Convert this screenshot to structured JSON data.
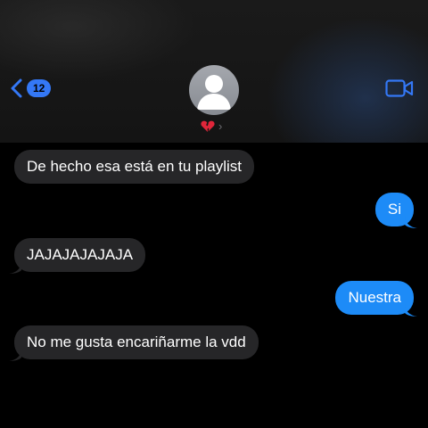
{
  "header": {
    "back_badge": "12",
    "contact_chevron": "›",
    "colors": {
      "accent": "#3478f6",
      "avatar": "#9a9ca2"
    },
    "icons": [
      "chevron-left-icon",
      "person-icon",
      "broken-heart-icon",
      "video-camera-icon"
    ]
  },
  "messages": [
    {
      "direction": "incoming",
      "text": "De hecho esa está en tu playlist"
    },
    {
      "direction": "outgoing",
      "text": "Si"
    },
    {
      "direction": "incoming",
      "text": "JAJAJAJAJAJA"
    },
    {
      "direction": "outgoing",
      "text": "Nuestra"
    },
    {
      "direction": "incoming",
      "text": "No me gusta encariñarme la vdd"
    }
  ],
  "colors": {
    "incoming_bubble": "#262628",
    "outgoing_bubble": "#1d8bf7",
    "background": "#000000"
  }
}
